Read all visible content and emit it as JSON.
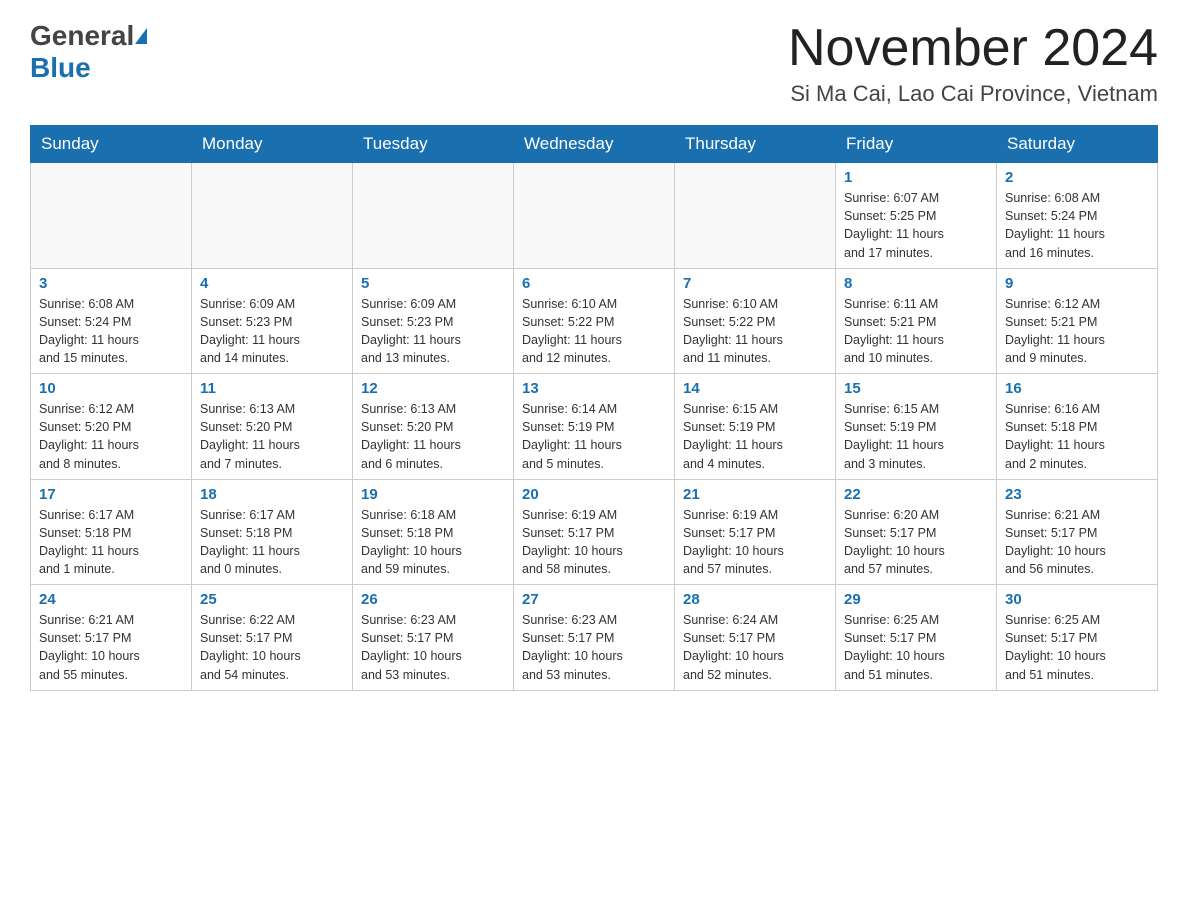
{
  "header": {
    "logo_general": "General",
    "logo_blue": "Blue",
    "month_title": "November 2024",
    "location": "Si Ma Cai, Lao Cai Province, Vietnam"
  },
  "weekdays": [
    "Sunday",
    "Monday",
    "Tuesday",
    "Wednesday",
    "Thursday",
    "Friday",
    "Saturday"
  ],
  "weeks": [
    [
      {
        "num": "",
        "info": ""
      },
      {
        "num": "",
        "info": ""
      },
      {
        "num": "",
        "info": ""
      },
      {
        "num": "",
        "info": ""
      },
      {
        "num": "",
        "info": ""
      },
      {
        "num": "1",
        "info": "Sunrise: 6:07 AM\nSunset: 5:25 PM\nDaylight: 11 hours\nand 17 minutes."
      },
      {
        "num": "2",
        "info": "Sunrise: 6:08 AM\nSunset: 5:24 PM\nDaylight: 11 hours\nand 16 minutes."
      }
    ],
    [
      {
        "num": "3",
        "info": "Sunrise: 6:08 AM\nSunset: 5:24 PM\nDaylight: 11 hours\nand 15 minutes."
      },
      {
        "num": "4",
        "info": "Sunrise: 6:09 AM\nSunset: 5:23 PM\nDaylight: 11 hours\nand 14 minutes."
      },
      {
        "num": "5",
        "info": "Sunrise: 6:09 AM\nSunset: 5:23 PM\nDaylight: 11 hours\nand 13 minutes."
      },
      {
        "num": "6",
        "info": "Sunrise: 6:10 AM\nSunset: 5:22 PM\nDaylight: 11 hours\nand 12 minutes."
      },
      {
        "num": "7",
        "info": "Sunrise: 6:10 AM\nSunset: 5:22 PM\nDaylight: 11 hours\nand 11 minutes."
      },
      {
        "num": "8",
        "info": "Sunrise: 6:11 AM\nSunset: 5:21 PM\nDaylight: 11 hours\nand 10 minutes."
      },
      {
        "num": "9",
        "info": "Sunrise: 6:12 AM\nSunset: 5:21 PM\nDaylight: 11 hours\nand 9 minutes."
      }
    ],
    [
      {
        "num": "10",
        "info": "Sunrise: 6:12 AM\nSunset: 5:20 PM\nDaylight: 11 hours\nand 8 minutes."
      },
      {
        "num": "11",
        "info": "Sunrise: 6:13 AM\nSunset: 5:20 PM\nDaylight: 11 hours\nand 7 minutes."
      },
      {
        "num": "12",
        "info": "Sunrise: 6:13 AM\nSunset: 5:20 PM\nDaylight: 11 hours\nand 6 minutes."
      },
      {
        "num": "13",
        "info": "Sunrise: 6:14 AM\nSunset: 5:19 PM\nDaylight: 11 hours\nand 5 minutes."
      },
      {
        "num": "14",
        "info": "Sunrise: 6:15 AM\nSunset: 5:19 PM\nDaylight: 11 hours\nand 4 minutes."
      },
      {
        "num": "15",
        "info": "Sunrise: 6:15 AM\nSunset: 5:19 PM\nDaylight: 11 hours\nand 3 minutes."
      },
      {
        "num": "16",
        "info": "Sunrise: 6:16 AM\nSunset: 5:18 PM\nDaylight: 11 hours\nand 2 minutes."
      }
    ],
    [
      {
        "num": "17",
        "info": "Sunrise: 6:17 AM\nSunset: 5:18 PM\nDaylight: 11 hours\nand 1 minute."
      },
      {
        "num": "18",
        "info": "Sunrise: 6:17 AM\nSunset: 5:18 PM\nDaylight: 11 hours\nand 0 minutes."
      },
      {
        "num": "19",
        "info": "Sunrise: 6:18 AM\nSunset: 5:18 PM\nDaylight: 10 hours\nand 59 minutes."
      },
      {
        "num": "20",
        "info": "Sunrise: 6:19 AM\nSunset: 5:17 PM\nDaylight: 10 hours\nand 58 minutes."
      },
      {
        "num": "21",
        "info": "Sunrise: 6:19 AM\nSunset: 5:17 PM\nDaylight: 10 hours\nand 57 minutes."
      },
      {
        "num": "22",
        "info": "Sunrise: 6:20 AM\nSunset: 5:17 PM\nDaylight: 10 hours\nand 57 minutes."
      },
      {
        "num": "23",
        "info": "Sunrise: 6:21 AM\nSunset: 5:17 PM\nDaylight: 10 hours\nand 56 minutes."
      }
    ],
    [
      {
        "num": "24",
        "info": "Sunrise: 6:21 AM\nSunset: 5:17 PM\nDaylight: 10 hours\nand 55 minutes."
      },
      {
        "num": "25",
        "info": "Sunrise: 6:22 AM\nSunset: 5:17 PM\nDaylight: 10 hours\nand 54 minutes."
      },
      {
        "num": "26",
        "info": "Sunrise: 6:23 AM\nSunset: 5:17 PM\nDaylight: 10 hours\nand 53 minutes."
      },
      {
        "num": "27",
        "info": "Sunrise: 6:23 AM\nSunset: 5:17 PM\nDaylight: 10 hours\nand 53 minutes."
      },
      {
        "num": "28",
        "info": "Sunrise: 6:24 AM\nSunset: 5:17 PM\nDaylight: 10 hours\nand 52 minutes."
      },
      {
        "num": "29",
        "info": "Sunrise: 6:25 AM\nSunset: 5:17 PM\nDaylight: 10 hours\nand 51 minutes."
      },
      {
        "num": "30",
        "info": "Sunrise: 6:25 AM\nSunset: 5:17 PM\nDaylight: 10 hours\nand 51 minutes."
      }
    ]
  ]
}
